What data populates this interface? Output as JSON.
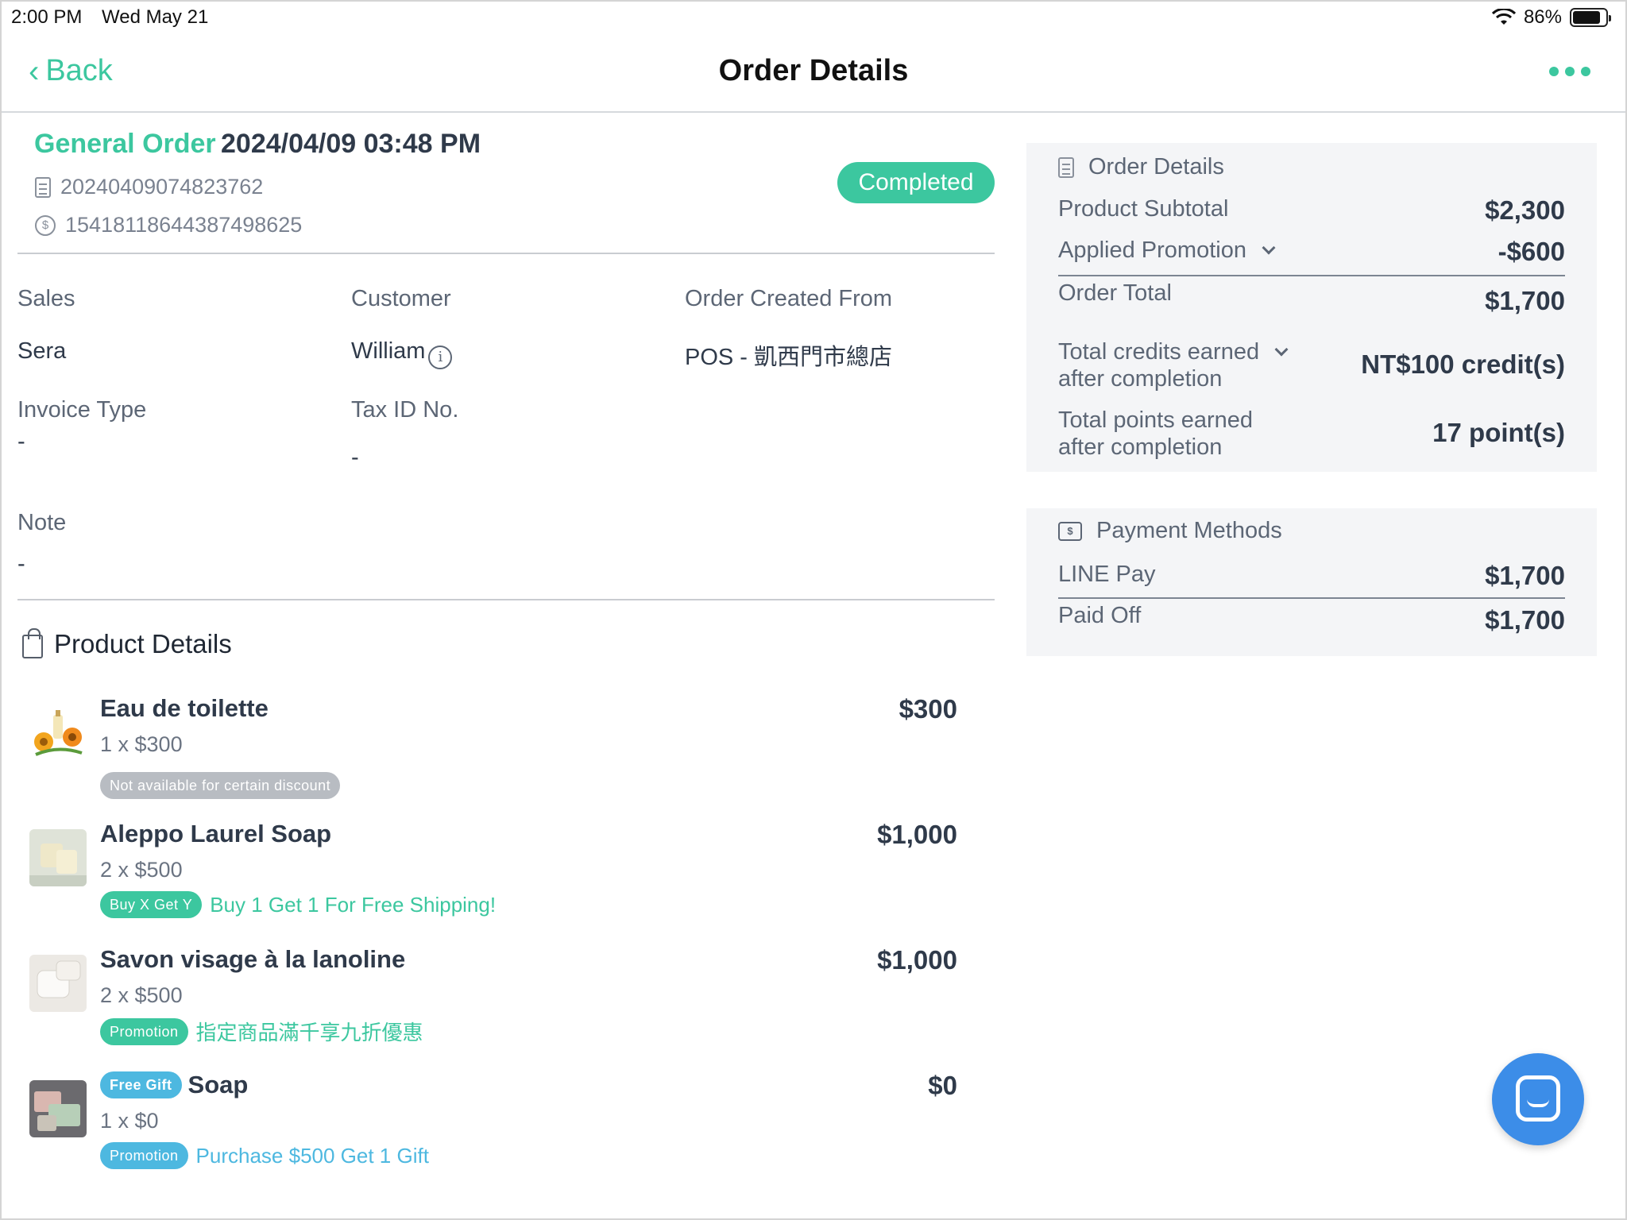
{
  "status_bar": {
    "time": "2:00 PM",
    "date": "Wed May 21",
    "battery": "86%"
  },
  "nav": {
    "back_label": "Back",
    "title": "Order Details"
  },
  "order": {
    "type": "General Order",
    "datetime": "2024/04/09 03:48 PM",
    "order_number": "20240409074823762",
    "transaction_number": "15418118644387498625",
    "status": "Completed"
  },
  "info": {
    "sales_label": "Sales",
    "sales_value": "Sera",
    "customer_label": "Customer",
    "customer_value": "William",
    "created_from_label": "Order Created From",
    "created_from_value": "POS - 凱西門市總店",
    "invoice_type_label": "Invoice Type",
    "invoice_type_value": "-",
    "tax_id_label": "Tax ID No.",
    "tax_id_value": "-",
    "note_label": "Note",
    "note_value": "-"
  },
  "products": {
    "section_title": "Product Details",
    "items": [
      {
        "name": "Eau de toilette",
        "qty": "1 x $300",
        "price": "$300",
        "tag": "Not available for certain discount",
        "tag_text": ""
      },
      {
        "name": "Aleppo Laurel Soap",
        "qty": "2 x $500",
        "price": "$1,000",
        "tag": "Buy X Get Y",
        "tag_text": "Buy 1 Get 1 For Free Shipping!"
      },
      {
        "name": "Savon visage à la lanoline",
        "qty": "2 x $500",
        "price": "$1,000",
        "tag": "Promotion",
        "tag_text": "指定商品滿千享九折優惠"
      },
      {
        "name": "Soap",
        "prefix_tag": "Free Gift",
        "qty": "1 x $0",
        "price": "$0",
        "tag": "Promotion",
        "tag_text": "Purchase $500 Get 1 Gift"
      }
    ]
  },
  "summary": {
    "title": "Order Details",
    "subtotal_label": "Product Subtotal",
    "subtotal": "$2,300",
    "promotion_label": "Applied Promotion",
    "promotion": "-$600",
    "total_label": "Order Total",
    "total": "$1,700",
    "credits_label_1": "Total credits earned",
    "credits_label_2": "after completion",
    "credits": "NT$100 credit(s)",
    "points_label_1": "Total points earned",
    "points_label_2": "after completion",
    "points": "17 point(s)"
  },
  "payment": {
    "title": "Payment Methods",
    "method_label": "LINE Pay",
    "method_amount": "$1,700",
    "paid_label": "Paid Off",
    "paid_amount": "$1,700"
  },
  "icons": {
    "accent": "#3cc79f",
    "promo_blue": "#4db8e0",
    "fab": "#3c8de8"
  }
}
